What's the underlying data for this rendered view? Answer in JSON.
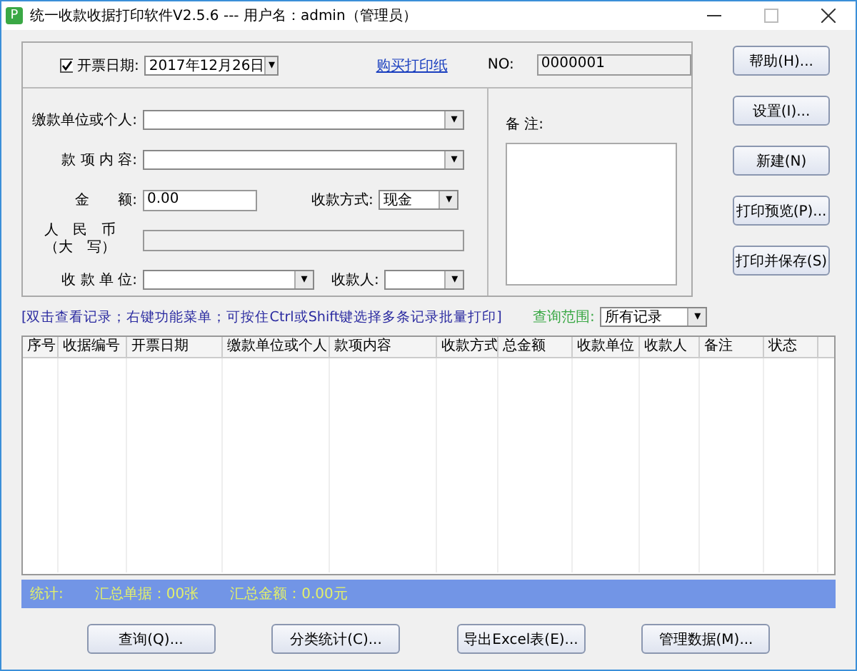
{
  "window": {
    "title": "统一收款收据打印软件V2.5.6 --- 用户名：admin（管理员）",
    "icon": "P"
  },
  "header": {
    "date_checkbox": {
      "label": "开票日期:",
      "checked": true
    },
    "date": "2017年12月26日",
    "dropdown_glyph": "▾",
    "buy_link": "购买打印纸",
    "no_label": "NO:",
    "no_value": "0000001"
  },
  "form": {
    "payer_label": "缴款单位或个人:",
    "item_label": "款 项 内 容:",
    "amount_label": "金　　额:",
    "amount_value": "0.00",
    "method_label": "收款方式:",
    "method_value": "现金",
    "rmb_label_1": "人　民　币",
    "rmb_label_2": "（大　写）",
    "unit_label": "收 款 单 位:",
    "receiver_label": "收款人:"
  },
  "note": {
    "label": "备 注:"
  },
  "side_buttons": [
    "帮助(H)...",
    "设置(I)...",
    "新建(N)",
    "打印预览(P)...",
    "打印并保存(S)"
  ],
  "hint": "[双击查看记录；右键功能菜单；可按住Ctrl或Shift键选择多条记录批量打印]",
  "range": {
    "label": "查询范围:",
    "value": "所有记录"
  },
  "table": {
    "columns": [
      "序号",
      "收据编号",
      "开票日期",
      "缴款单位或个人",
      "款项内容",
      "收款方式",
      "总金额",
      "收款单位",
      "收款人",
      "备注",
      "状态"
    ]
  },
  "status_bar": [
    "统计:",
    "汇总单据：00张",
    "汇总金额：0.00元"
  ],
  "bottom_buttons": [
    "查询(Q)...",
    "分类统计(C)...",
    "导出Excel表(E)...",
    "管理数据(M)..."
  ]
}
